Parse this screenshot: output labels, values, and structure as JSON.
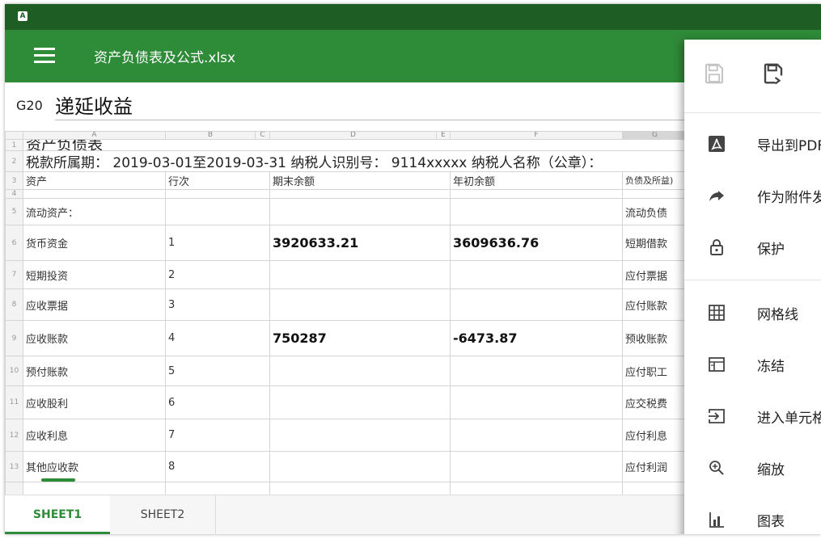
{
  "status": {
    "app_icon_letter": "A"
  },
  "appbar": {
    "title": "资产负债表及公式.xlsx"
  },
  "formula": {
    "cell_ref": "G20",
    "value": "递延收益"
  },
  "sheet": {
    "columns": [
      "",
      "A",
      "B",
      "C",
      "D",
      "E",
      "F",
      "G"
    ],
    "row1": {
      "num": "1",
      "a": "资产负债表"
    },
    "row2": {
      "num": "2",
      "text": "税款所属期： 2019-03-01至2019-03-31 纳税人识别号： 9114xxxxx 纳税人名称（公章）："
    },
    "row3": {
      "num": "3",
      "a": "资产",
      "b": "行次",
      "d": "期末余额",
      "f": "年初余额",
      "g": "负债及所益)"
    },
    "row4": {
      "num": "4"
    },
    "rows": [
      {
        "num": "5",
        "a": "流动资产：",
        "b": "",
        "d": "",
        "f": "",
        "g": "流动负债"
      },
      {
        "num": "6",
        "a": "货币资金",
        "b": "1",
        "d": "3920633.21",
        "f": "3609636.76",
        "g": "短期借款"
      },
      {
        "num": "7",
        "a": "短期投资",
        "b": "2",
        "d": "",
        "f": "",
        "g": "应付票据"
      },
      {
        "num": "8",
        "a": "应收票据",
        "b": "3",
        "d": "",
        "f": "",
        "g": "应付账款"
      },
      {
        "num": "9",
        "a": "应收账款",
        "b": "4",
        "d": "750287",
        "f": "-6473.87",
        "g": "预收账款"
      },
      {
        "num": "10",
        "a": "预付账款",
        "b": "5",
        "d": "",
        "f": "",
        "g": "应付职工"
      },
      {
        "num": "11",
        "a": "应收股利",
        "b": "6",
        "d": "",
        "f": "",
        "g": "应交税费"
      },
      {
        "num": "12",
        "a": "应收利息",
        "b": "7",
        "d": "",
        "f": "",
        "g": "应付利息"
      },
      {
        "num": "13",
        "a": "其他应收款",
        "b": "8",
        "d": "",
        "f": "",
        "g": "应付利润"
      }
    ]
  },
  "tabs": [
    "SHEET1",
    "SHEET2"
  ],
  "menu": {
    "top_icons": [
      "save-disabled-icon",
      "save-as-icon"
    ],
    "items": [
      {
        "label": "导出到PDF",
        "icon": "pdf-icon"
      },
      {
        "label": "作为附件发送",
        "icon": "share-arrow-icon"
      },
      {
        "label": "保护",
        "icon": "lock-icon"
      },
      {
        "label": "网格线",
        "icon": "grid-icon"
      },
      {
        "label": "冻结",
        "icon": "freeze-icon"
      },
      {
        "label": "进入单元格",
        "icon": "enter-cell-icon"
      },
      {
        "label": "缩放",
        "icon": "zoom-icon"
      },
      {
        "label": "图表",
        "icon": "chart-icon"
      }
    ]
  },
  "colors": {
    "status_bar": "#1e5e25",
    "app_bar": "#2e8b38",
    "accent": "#2e8b38"
  }
}
